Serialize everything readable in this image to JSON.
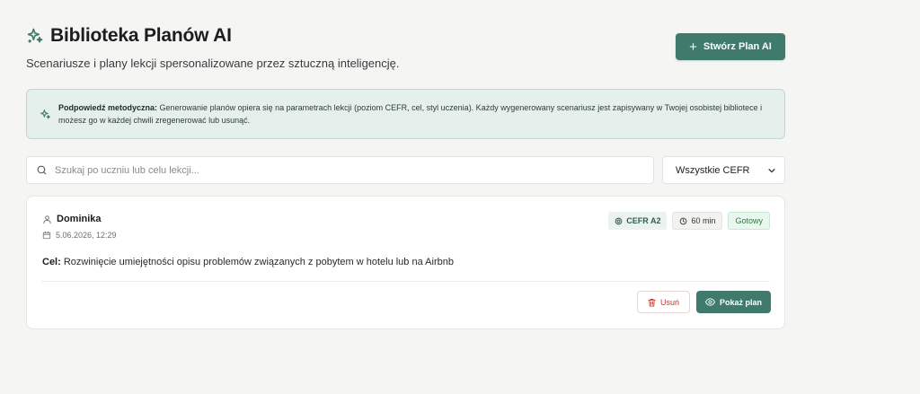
{
  "header": {
    "title": "Biblioteka Planów AI",
    "subtitle": "Scenariusze i plany lekcji spersonalizowane przez sztuczną inteligencję.",
    "icon": "sparkles-icon"
  },
  "actions": {
    "create_label": "Stwórz Plan AI"
  },
  "tip": {
    "label": "Podpowiedź metodyczna:",
    "text": "Generowanie planów opiera się na parametrach lekcji (poziom CEFR, cel, styl uczenia). Każdy wygenerowany scenariusz jest zapisywany w Twojej osobistej bibliotece i możesz go w każdej chwili zregenerować lub usunąć."
  },
  "filters": {
    "search_placeholder": "Szukaj po uczniu lub celu lekcji...",
    "search_value": "",
    "cefr_selected": "Wszystkie CEFR"
  },
  "plans": [
    {
      "student": "Dominika",
      "date": "5.06.2026, 12:29",
      "cefr": "CEFR A2",
      "duration": "60 min",
      "status": "Gotowy",
      "goal_label": "Cel:",
      "goal": "Rozwinięcie umiejętności opisu problemów związanych z pobytem w hotelu lub na Airbnb",
      "delete_label": "Usuń",
      "show_label": "Pokaż plan"
    }
  ],
  "colors": {
    "accent": "#3f7a6c",
    "tip_bg": "#e5f0ed",
    "danger": "#c0392b",
    "status_green": "#2e7a45"
  }
}
